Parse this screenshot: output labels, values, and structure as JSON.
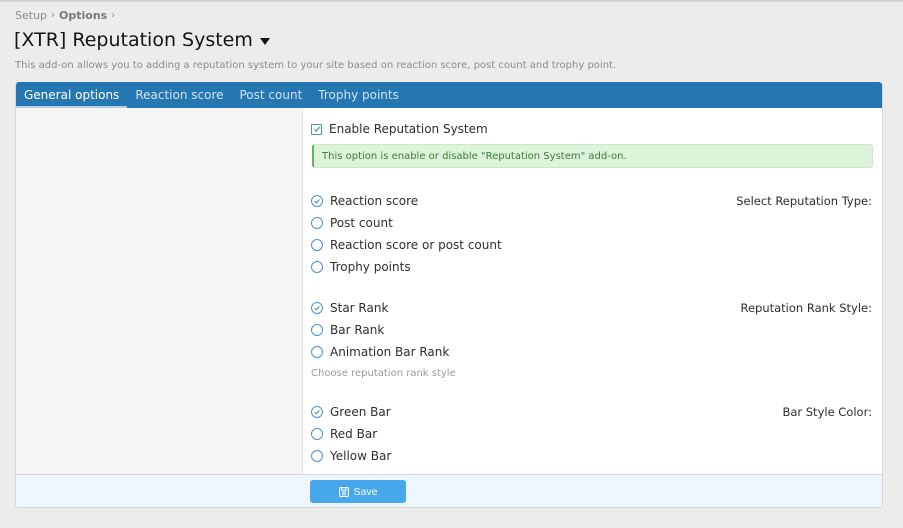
{
  "breadcrumb": [
    {
      "label": "Setup",
      "bold": false
    },
    {
      "label": "Options",
      "bold": true
    }
  ],
  "breadcrumb_separator": "›",
  "page": {
    "title": "[XTR] Reputation System",
    "description": "This add-on allows you to adding a reputation system to your site based on reaction score, post count and trophy point."
  },
  "tabs": [
    {
      "label": "General options",
      "active": true
    },
    {
      "label": "Reaction score",
      "active": false
    },
    {
      "label": "Post count",
      "active": false
    },
    {
      "label": "Trophy points",
      "active": false
    }
  ],
  "form": {
    "enable": {
      "label": "Enable Reputation System",
      "checked": true,
      "hint": "This option is enable or disable \"Reputation System\" add-on."
    },
    "reputation_type": {
      "label": "Select Reputation Type:",
      "options": [
        {
          "label": "Reaction score",
          "selected": true
        },
        {
          "label": "Post count",
          "selected": false
        },
        {
          "label": "Reaction score or post count",
          "selected": false
        },
        {
          "label": "Trophy points",
          "selected": false
        }
      ]
    },
    "rank_style": {
      "label": "Reputation Rank Style:",
      "options": [
        {
          "label": "Star Rank",
          "selected": true
        },
        {
          "label": "Bar Rank",
          "selected": false
        },
        {
          "label": "Animation Bar Rank",
          "selected": false
        }
      ],
      "explain": "Choose reputation rank style"
    },
    "bar_color": {
      "label": "Bar Style Color:",
      "options": [
        {
          "label": "Green Bar",
          "selected": true
        },
        {
          "label": "Red Bar",
          "selected": false
        },
        {
          "label": "Yellow Bar",
          "selected": false
        }
      ]
    }
  },
  "footer": {
    "save_label": "Save",
    "save_icon": "floppy-disk-icon"
  },
  "colors": {
    "tab_bar": "#2577b1",
    "accent": "#4b8fd0",
    "save_button": "#47a7eb",
    "hint_bg": "#dcf3da",
    "hint_border": "#63b25e"
  }
}
